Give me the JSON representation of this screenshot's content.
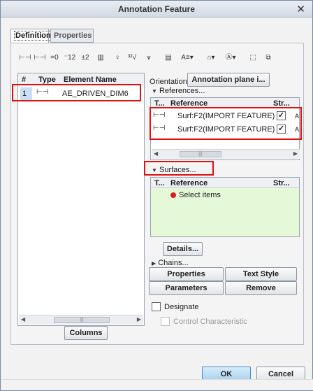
{
  "window": {
    "title": "Annotation Feature",
    "close_glyph": "✕"
  },
  "tabs": [
    {
      "label": "Definition",
      "active": true
    },
    {
      "label": "Properties",
      "active": false
    }
  ],
  "toolbar": {
    "icons": [
      "dimension-icon",
      "ordinate-dimension-icon",
      "reference-dimension-icon",
      "baseline-icon",
      "tolerance-icon",
      "datum-icon",
      "datum-target-icon",
      "surface-finish-icon",
      "weld-symbol-icon",
      "note-icon",
      "text-style-icon",
      "symbol-icon",
      "frame-icon",
      "copy-icon"
    ]
  },
  "element_list": {
    "columns": [
      "#",
      "Type",
      "Element Name"
    ],
    "rows": [
      {
        "num": "1",
        "type_icon": "dimension-icon",
        "name": "AE_DRIVEN_DIM6"
      }
    ]
  },
  "columns_button": "Columns",
  "orientation": {
    "label": "Orientation",
    "button": "Annotation plane i..."
  },
  "references": {
    "label": "References...",
    "columns": [
      "T...",
      "Reference",
      "Str..."
    ],
    "rows": [
      {
        "type_icon": "dimension-icon",
        "reference": "Surf:F2(IMPORT FEATURE)",
        "checked": true,
        "extra": "A"
      },
      {
        "type_icon": "dimension-icon",
        "reference": "Surf:F2(IMPORT FEATURE)",
        "checked": true,
        "extra": "A"
      }
    ]
  },
  "surfaces": {
    "label": "Surfaces...",
    "columns": [
      "T...",
      "Reference",
      "Str..."
    ],
    "select_prompt": "Select items"
  },
  "details_button": "Details...",
  "chains_label": "Chains...",
  "actions": {
    "properties": "Properties",
    "text_style": "Text Style",
    "parameters": "Parameters",
    "remove": "Remove"
  },
  "designate": {
    "label": "Designate",
    "checked": false
  },
  "control_characteristic": {
    "label": "Control Characteristic",
    "checked": false,
    "enabled": false
  },
  "footer": {
    "ok": "OK",
    "cancel": "Cancel"
  },
  "colors": {
    "highlight_red": "#e01010",
    "selection_blue": "#c9def5",
    "surfaces_green": "#e5f8d8"
  }
}
